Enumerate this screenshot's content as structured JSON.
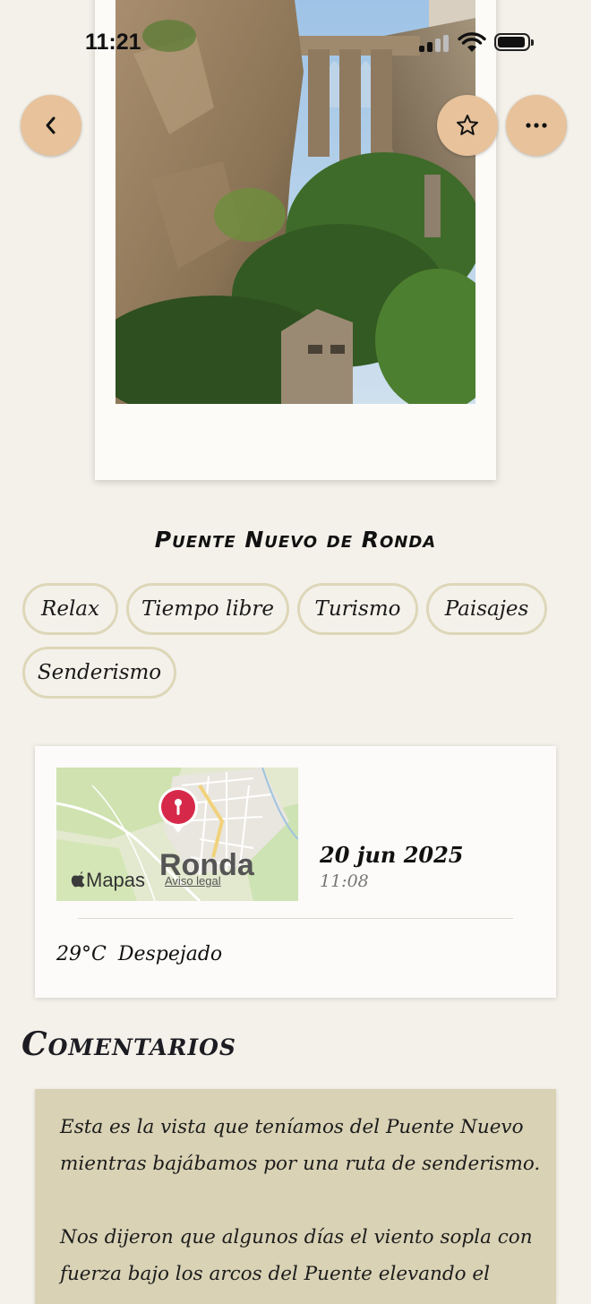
{
  "status_bar": {
    "time": "11:21"
  },
  "header": {
    "back_icon": "chevron-left-icon",
    "favorite_icon": "star-icon",
    "more_icon": "ellipsis-icon",
    "button_color": "#e7c29b"
  },
  "place": {
    "title": "Puente Nuevo de Ronda"
  },
  "tags": [
    "Relax",
    "Tiempo libre",
    "Turismo",
    "Paisajes",
    "Senderismo"
  ],
  "info": {
    "map": {
      "brand": "Mapas",
      "legal": "Aviso legal",
      "city": "Ronda",
      "pin_color": "#d6294a"
    },
    "date": "20 jun 2025",
    "time": "11:08",
    "weather": {
      "temperature": "29°C",
      "condition": "Despejado"
    }
  },
  "comments": {
    "title": "Comentarios",
    "text": "Esta es la vista que teníamos del Puente Nuevo mientras bajábamos por una ruta de senderismo.\n\nNos dijeron que algunos días el viento sopla con fuerza bajo los arcos del Puente elevando el"
  }
}
